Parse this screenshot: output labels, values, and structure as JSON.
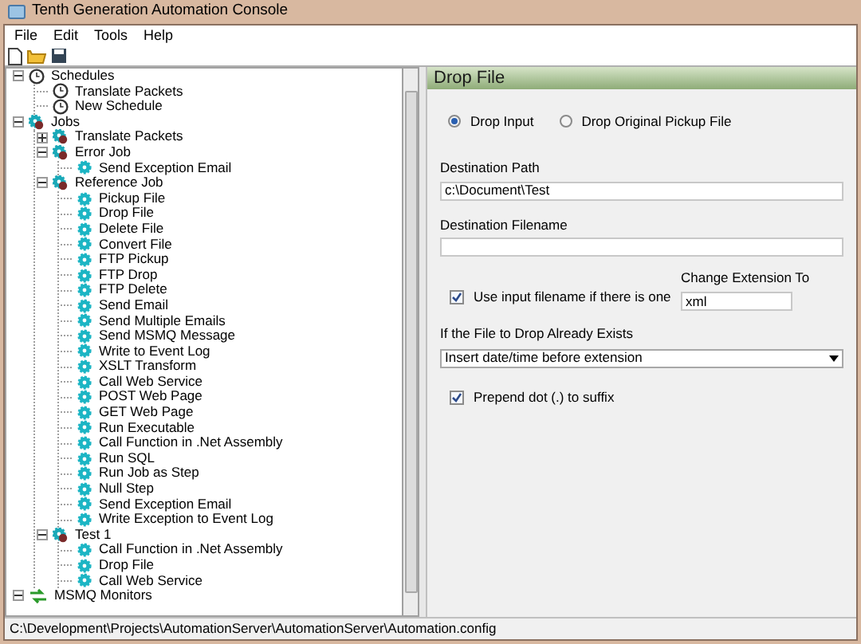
{
  "window": {
    "title": "Tenth Generation Automation Console"
  },
  "menu": [
    {
      "label": "File"
    },
    {
      "label": "Edit"
    },
    {
      "label": "Tools"
    },
    {
      "label": "Help"
    }
  ],
  "tree": [
    {
      "kind": "schedules",
      "label": "Schedules",
      "expanded": true,
      "children": [
        {
          "kind": "schedule",
          "label": "Translate Packets"
        },
        {
          "kind": "schedule",
          "label": "New Schedule"
        }
      ]
    },
    {
      "kind": "jobs",
      "label": "Jobs",
      "expanded": true,
      "children": [
        {
          "kind": "job",
          "label": "Translate Packets",
          "expanded": false
        },
        {
          "kind": "job",
          "label": "Error Job",
          "expanded": true,
          "children": [
            {
              "kind": "step",
              "label": "Send Exception Email"
            }
          ]
        },
        {
          "kind": "job",
          "label": "Reference Job",
          "expanded": true,
          "children": [
            {
              "kind": "step",
              "label": "Pickup File"
            },
            {
              "kind": "step",
              "label": "Drop File"
            },
            {
              "kind": "step",
              "label": "Delete File"
            },
            {
              "kind": "step",
              "label": "Convert File"
            },
            {
              "kind": "step",
              "label": "FTP Pickup"
            },
            {
              "kind": "step",
              "label": "FTP Drop"
            },
            {
              "kind": "step",
              "label": "FTP Delete"
            },
            {
              "kind": "step",
              "label": "Send Email"
            },
            {
              "kind": "step",
              "label": "Send Multiple Emails"
            },
            {
              "kind": "step",
              "label": "Send MSMQ Message"
            },
            {
              "kind": "step",
              "label": "Write to Event Log"
            },
            {
              "kind": "step",
              "label": "XSLT Transform"
            },
            {
              "kind": "step",
              "label": "Call Web Service"
            },
            {
              "kind": "step",
              "label": "POST Web Page"
            },
            {
              "kind": "step",
              "label": "GET Web Page"
            },
            {
              "kind": "step",
              "label": "Run Executable"
            },
            {
              "kind": "step",
              "label": "Call Function in .Net Assembly"
            },
            {
              "kind": "step",
              "label": "Run SQL"
            },
            {
              "kind": "step",
              "label": "Run Job as Step"
            },
            {
              "kind": "step",
              "label": "Null Step"
            },
            {
              "kind": "step",
              "label": "Send Exception Email"
            },
            {
              "kind": "step",
              "label": "Write Exception to Event Log"
            }
          ]
        },
        {
          "kind": "job",
          "label": "Test 1",
          "expanded": true,
          "children": [
            {
              "kind": "step",
              "label": "Call Function in .Net Assembly"
            },
            {
              "kind": "step",
              "label": "Drop File"
            },
            {
              "kind": "step",
              "label": "Call Web Service"
            }
          ]
        }
      ]
    },
    {
      "kind": "monitors",
      "label": "MSMQ Monitors",
      "expanded": true
    }
  ],
  "panel": {
    "title": "Drop File",
    "radios": [
      {
        "label": "Drop Input",
        "selected": true
      },
      {
        "label": "Drop Original Pickup File",
        "selected": false
      }
    ],
    "destination_path": {
      "label": "Destination Path",
      "value": "c:\\Document\\Test"
    },
    "destination_filename": {
      "label": "Destination Filename"
    },
    "use_input_filename": {
      "label": "Use input filename if there is one",
      "checked": true
    },
    "change_extension": {
      "label": "Change Extension To",
      "value": "xml"
    },
    "if_exists": {
      "label": "If the File to Drop Already Exists",
      "value": "Insert date/time before extension"
    },
    "prepend_dot": {
      "label": "Prepend dot (.) to suffix",
      "checked": true
    }
  },
  "status_bar": {
    "text": "C:\\Development\\Projects\\AutomationServer\\AutomationServer\\Automation.config"
  }
}
